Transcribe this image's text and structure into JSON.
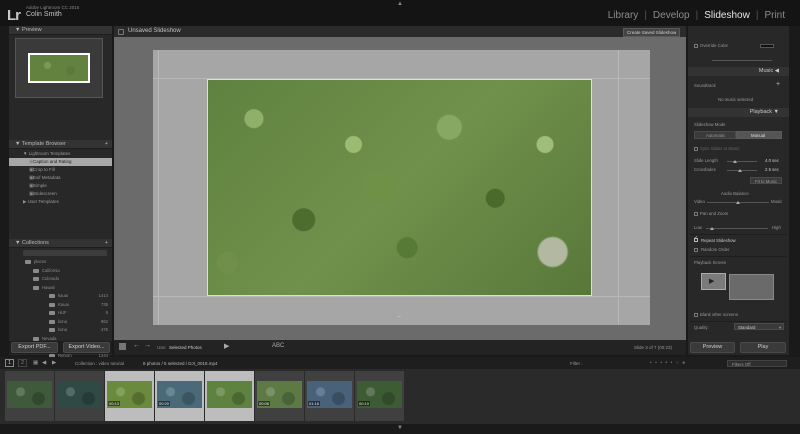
{
  "app": {
    "logo": "Lr",
    "name": "Adobe Lightroom CC 2015",
    "user": "Colin Smith"
  },
  "modules": [
    {
      "label": "Library",
      "active": false
    },
    {
      "label": "Develop",
      "active": false
    },
    {
      "label": "Slideshow",
      "active": true
    },
    {
      "label": "Print",
      "active": false
    }
  ],
  "left": {
    "preview_header": "Preview",
    "template_browser_header": "Template Browser",
    "templates_folder": "Lightroom Templates",
    "templates": [
      "Caption and Rating",
      "Crop to Fill",
      "Exif Metadata",
      "Simple",
      "Widescreen"
    ],
    "selected_template": "Caption and Rating",
    "user_templates": "User Templates",
    "collections_header": "Collections",
    "collections": [
      {
        "label": "places",
        "count": ""
      },
      {
        "label": "California",
        "count": ""
      },
      {
        "label": "Colorado",
        "count": ""
      },
      {
        "label": "Hawaii",
        "count": ""
      },
      {
        "label": "kauai",
        "count": "1414"
      },
      {
        "label": "Kauai",
        "count": "735"
      },
      {
        "label": "HUF",
        "count": "5"
      },
      {
        "label": "kona",
        "count": "862"
      },
      {
        "label": "kona",
        "count": "476"
      },
      {
        "label": "Nevada",
        "count": ""
      },
      {
        "label": "las v",
        "count": "107"
      },
      {
        "label": "Reborn",
        "count": "1344"
      }
    ],
    "export_pdf": "Export PDF...",
    "export_video": "Export Video..."
  },
  "center": {
    "slideshow_name": "Unsaved Slideshow",
    "save_button": "Create Saved Slideshow",
    "handle": "⇔"
  },
  "toolbar": {
    "use_label": "Use:",
    "use_value": "Selected Photos",
    "abc": "ABC",
    "slide_count": "Slide 3 of 7 (00:23)"
  },
  "right": {
    "override_color": "Override Color",
    "music_header": "Music",
    "soundtrack": "Soundtrack",
    "no_music": "No music selected",
    "playback_header": "Playback",
    "slideshow_mode": "Slideshow Mode",
    "mode_automatic": "Automatic",
    "mode_manual": "Manual",
    "sync_slides": "Sync Slides to Music",
    "slide_length_label": "Slide Length",
    "slide_length_value": "4.0 sec",
    "crossfades_label": "Crossfades",
    "crossfades_value": "2.5 sec",
    "fit_to_music": "Fit to Music",
    "audio_balance": "Audio Balance",
    "video_label": "Video",
    "music_label": "Music",
    "pan_zoom": "Pan and Zoom",
    "low": "Low",
    "high": "High",
    "repeat_slideshow": "Repeat Slideshow",
    "random_order": "Random Order",
    "playback_screen": "Playback Screen",
    "blank_other": "Blank other screens",
    "quality_label": "Quality:",
    "quality_value": "Standard",
    "preview_btn": "Preview",
    "play_btn": "Play"
  },
  "filmstrip_bar": {
    "pages": [
      "1",
      "2"
    ],
    "path": "Collection : video tutorial",
    "selection_info": "8 photos / 5 selected / DJI_0018.mp4",
    "filter_label": "Filter :",
    "filters_off": "Filters Off"
  },
  "filmstrip": [
    {
      "dur": "",
      "selected": false,
      "color": "#3f5a3a"
    },
    {
      "dur": "",
      "selected": false,
      "color": "#2f4a44"
    },
    {
      "dur": "00:13",
      "selected": true,
      "color": "#6a8a3c"
    },
    {
      "dur": "00:20",
      "selected": true,
      "color": "#4a6a7a"
    },
    {
      "dur": "",
      "selected": true,
      "color": "#5e8240"
    },
    {
      "dur": "00:06",
      "selected": false,
      "color": "#5d7a45"
    },
    {
      "dur": "01:16",
      "selected": false,
      "color": "#48627a"
    },
    {
      "dur": "00:10",
      "selected": false,
      "color": "#3e5c34"
    }
  ],
  "colors": {
    "accent": "#e6e6e6",
    "panel": "#282828",
    "selected_thumb": "#bdbdbd"
  }
}
